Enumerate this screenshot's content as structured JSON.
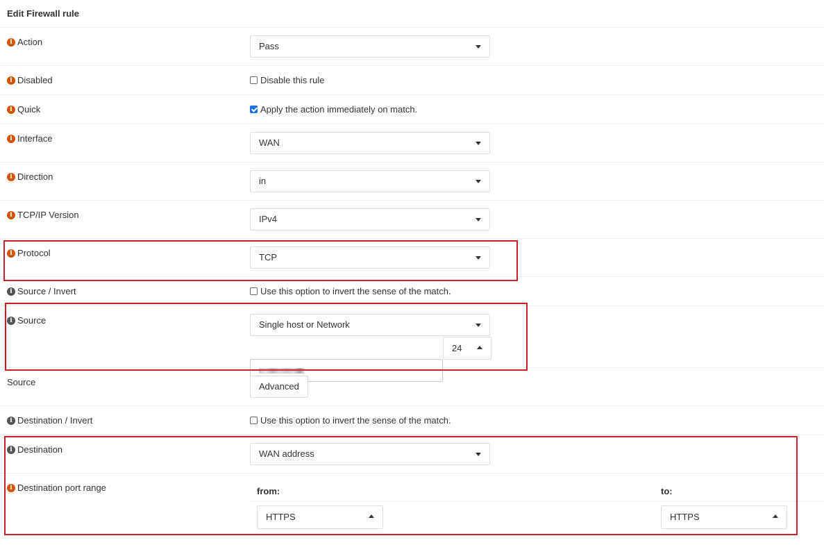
{
  "header": {
    "title": "Edit Firewall rule"
  },
  "rows": {
    "action": {
      "label": "Action",
      "value": "Pass"
    },
    "disabled": {
      "label": "Disabled",
      "checkbox_label": "Disable this rule",
      "checked": false
    },
    "quick": {
      "label": "Quick",
      "checkbox_label": "Apply the action immediately on match.",
      "checked": true
    },
    "interface": {
      "label": "Interface",
      "value": "WAN"
    },
    "direction": {
      "label": "Direction",
      "value": "in"
    },
    "tcpip": {
      "label": "TCP/IP Version",
      "value": "IPv4"
    },
    "protocol": {
      "label": "Protocol",
      "value": "TCP"
    },
    "source_invert": {
      "label": "Source / Invert",
      "checkbox_label": "Use this option to invert the sense of the match.",
      "checked": false
    },
    "source": {
      "label": "Source",
      "type_value": "Single host or Network",
      "mask_value": "24"
    },
    "source_adv": {
      "label": "Source",
      "button_label": "Advanced"
    },
    "dest_invert": {
      "label": "Destination / Invert",
      "checkbox_label": "Use this option to invert the sense of the match.",
      "checked": false
    },
    "destination": {
      "label": "Destination",
      "value": "WAN address"
    },
    "dest_port": {
      "label": "Destination port range",
      "from_label": "from:",
      "to_label": "to:",
      "from_value": "HTTPS",
      "to_value": "HTTPS"
    }
  },
  "colors": {
    "accent_icon": "#d35400",
    "highlight_border": "#cc1f2a",
    "checkbox_checked": "#1a73e8"
  },
  "icons": {
    "info": "info-icon",
    "dropdown": "caret-down-icon",
    "spinner": "caret-up-icon"
  }
}
